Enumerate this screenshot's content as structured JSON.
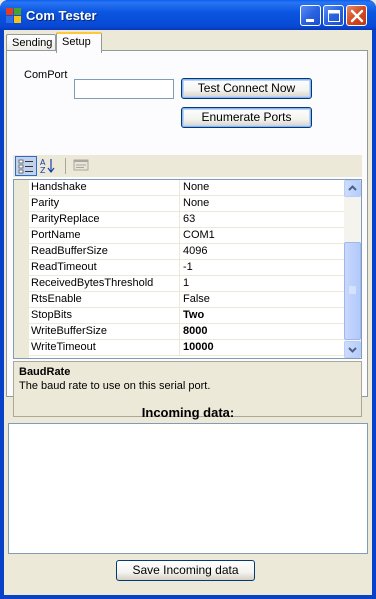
{
  "window": {
    "title": "Com Tester",
    "accent_color": "#0842c8"
  },
  "tabs": [
    {
      "label": "Sending",
      "active": false
    },
    {
      "label": "Setup",
      "active": true
    }
  ],
  "setup": {
    "comport_label": "ComPort",
    "comport_value": "",
    "test_connect_label": "Test Connect Now",
    "enumerate_ports_label": "Enumerate Ports"
  },
  "property_grid": {
    "toolbar": {
      "categorized_icon": "categorized-icon",
      "alphabetical_icon": "alphabetical-icon",
      "property_pages_icon": "property-pages-icon"
    },
    "rows": [
      {
        "name": "Handshake",
        "value": "None",
        "bold": false
      },
      {
        "name": "Parity",
        "value": "None",
        "bold": false
      },
      {
        "name": "ParityReplace",
        "value": "63",
        "bold": false
      },
      {
        "name": "PortName",
        "value": "COM1",
        "bold": false
      },
      {
        "name": "ReadBufferSize",
        "value": "4096",
        "bold": false
      },
      {
        "name": "ReadTimeout",
        "value": "-1",
        "bold": false
      },
      {
        "name": "ReceivedBytesThreshold",
        "value": "1",
        "bold": false
      },
      {
        "name": "RtsEnable",
        "value": "False",
        "bold": false
      },
      {
        "name": "StopBits",
        "value": "Two",
        "bold": true
      },
      {
        "name": "WriteBufferSize",
        "value": "8000",
        "bold": true
      },
      {
        "name": "WriteTimeout",
        "value": "10000",
        "bold": true
      }
    ],
    "description_title": "BaudRate",
    "description_text": "The baud rate to use on this serial port."
  },
  "incoming": {
    "title": "Incoming data:",
    "content": "",
    "save_label": "Save Incoming data"
  }
}
